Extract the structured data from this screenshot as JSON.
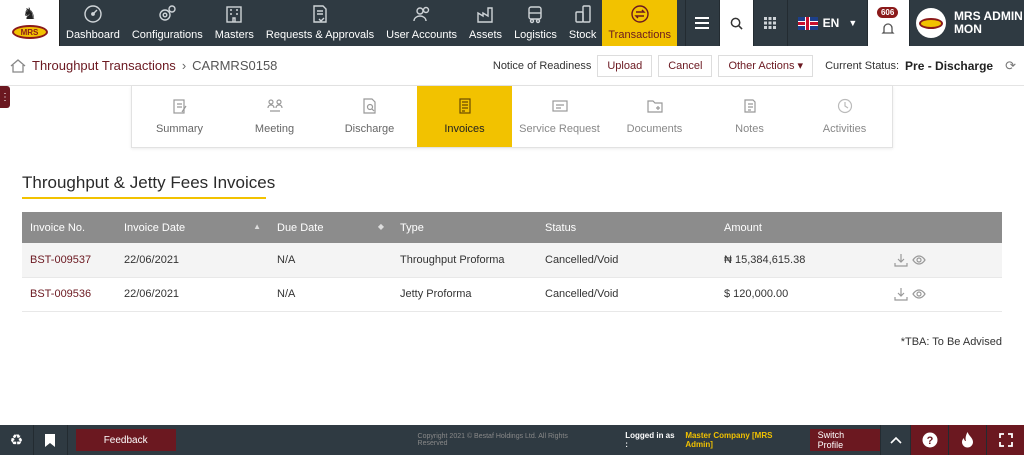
{
  "nav": {
    "items": [
      {
        "label": "Dashboard",
        "icon": "gauge-icon"
      },
      {
        "label": "Configurations",
        "icon": "gears-icon"
      },
      {
        "label": "Masters",
        "icon": "building-icon"
      },
      {
        "label": "Requests & Approvals",
        "icon": "document-check-icon"
      },
      {
        "label": "User Accounts",
        "icon": "users-icon"
      },
      {
        "label": "Assets",
        "icon": "factory-icon"
      },
      {
        "label": "Logistics",
        "icon": "truck-icon"
      },
      {
        "label": "Stock",
        "icon": "barrels-icon"
      },
      {
        "label": "Transactions",
        "icon": "exchange-icon"
      }
    ],
    "language": "EN",
    "notification_count": "606",
    "user_name": "MRS ADMIN",
    "user_code": "MON",
    "logo_text": "MRS"
  },
  "breadcrumb": {
    "section": "Throughput Transactions",
    "current": "CARMRS0158"
  },
  "actions": {
    "notice_label": "Notice of Readiness",
    "upload": "Upload",
    "cancel": "Cancel",
    "other": "Other Actions ▾",
    "status_label": "Current Status:",
    "status_value": "Pre - Discharge"
  },
  "tabs": [
    {
      "label": "Summary"
    },
    {
      "label": "Meeting"
    },
    {
      "label": "Discharge"
    },
    {
      "label": "Invoices"
    },
    {
      "label": "Service Request"
    },
    {
      "label": "Documents"
    },
    {
      "label": "Notes"
    },
    {
      "label": "Activities"
    }
  ],
  "page_title": "Throughput & Jetty Fees Invoices",
  "table": {
    "headers": [
      "Invoice No.",
      "Invoice Date",
      "Due Date",
      "Type",
      "Status",
      "Amount"
    ],
    "rows": [
      {
        "invoice_no": "BST-009537",
        "invoice_date": "22/06/2021",
        "due_date": "N/A",
        "type": "Throughput Proforma",
        "status": "Cancelled/Void",
        "amount": "₦ 15,384,615.38"
      },
      {
        "invoice_no": "BST-009536",
        "invoice_date": "22/06/2021",
        "due_date": "N/A",
        "type": "Jetty Proforma",
        "status": "Cancelled/Void",
        "amount": "$ 120,000.00"
      }
    ]
  },
  "tba_note": "*TBA: To Be Advised",
  "footer": {
    "feedback": "Feedback",
    "copyright": "Copyright 2021 © Bestaf Holdings Ltd. All Rights Reserved",
    "logged_in_label": "Logged in as :",
    "company": "Master Company [MRS Admin]",
    "switch_profile": "Switch Profile"
  },
  "colors": {
    "accent": "#f2c200",
    "brand": "#6b1820",
    "nav_bg": "#2f3a42",
    "table_header": "#8c8c8c"
  }
}
